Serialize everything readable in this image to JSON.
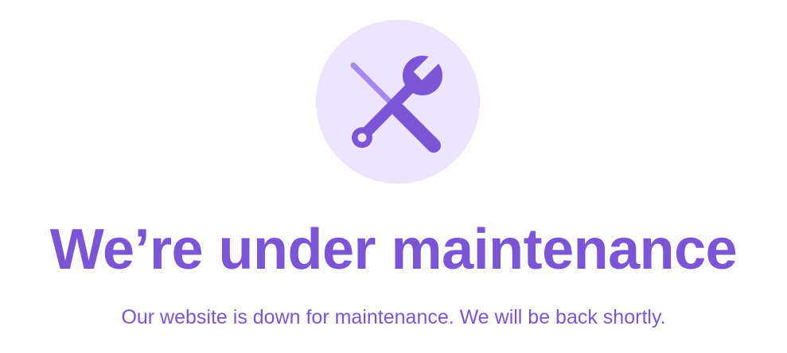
{
  "maintenance": {
    "icon": "tools-icon",
    "title": "We’re under maintenance",
    "message": "Our website is down for maintenance. We will be back shortly."
  },
  "colors": {
    "accent": "#7b55d6",
    "icon_background": "#ede4ff",
    "page_background": "#ffffff"
  }
}
